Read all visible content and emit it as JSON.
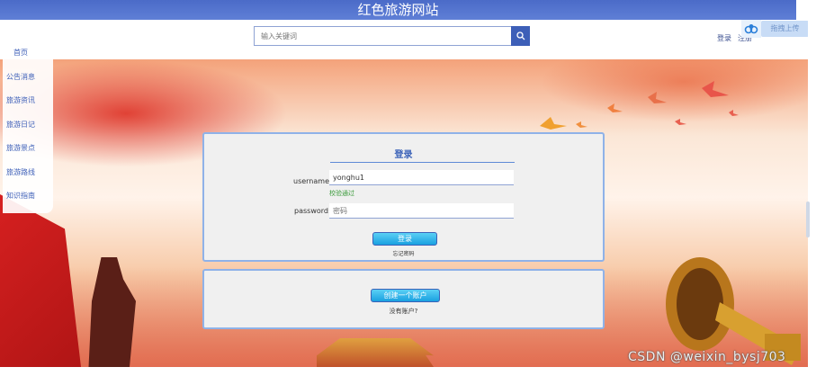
{
  "header": {
    "site_title": "红色旅游网站",
    "search_placeholder": "输入关键词",
    "login_label": "登录",
    "register_label": "注册",
    "upload_label": "拖拽上传"
  },
  "sidebar": {
    "items": [
      {
        "label": "首页"
      },
      {
        "label": "公告消息"
      },
      {
        "label": "旅游资讯"
      },
      {
        "label": "旅游日记"
      },
      {
        "label": "旅游景点"
      },
      {
        "label": "旅游路线"
      },
      {
        "label": "知识指南"
      }
    ]
  },
  "login_form": {
    "title": "登录",
    "username_label": "username:",
    "username_value": "yonghu1",
    "validation_text": "校验通过",
    "password_label": "password:",
    "password_placeholder": "密码",
    "submit_label": "登录",
    "forgot_label": "忘记密码"
  },
  "register": {
    "create_label": "创建一个账户",
    "no_account_label": "没有账户?"
  },
  "watermark": "CSDN @weixin_bysj703",
  "colors": {
    "header_blue": "#4b6bc8",
    "link_blue": "#3d5fb8",
    "card_border": "#8fb2e8",
    "button_cyan": "#1aa0e0",
    "valid_green": "#3a9a3a"
  }
}
